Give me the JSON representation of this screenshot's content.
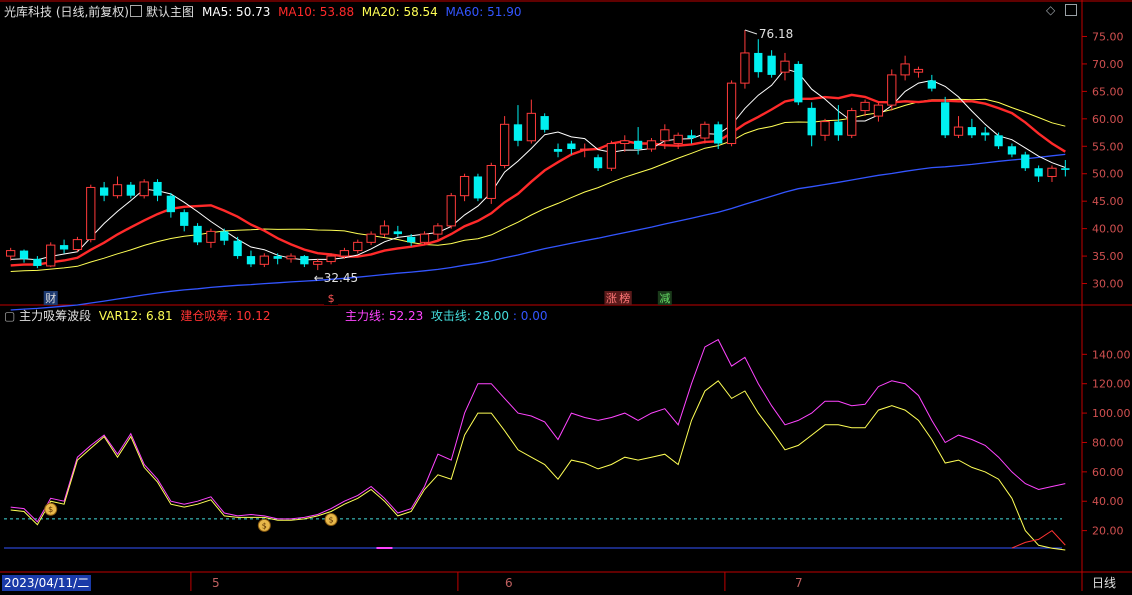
{
  "header": {
    "title": "光库科技 (日线,前复权)",
    "template": "默认主图",
    "ma": [
      {
        "label": "MA5: 50.73",
        "color": "#ffffff"
      },
      {
        "label": "MA10: 53.88",
        "color": "#ff2a2a"
      },
      {
        "label": "MA20: 58.54",
        "color": "#ffff55"
      },
      {
        "label": "MA60: 51.90",
        "color": "#3355ff"
      }
    ]
  },
  "indicator_header": {
    "name": "主力吸筹波段",
    "items": [
      {
        "label": "VAR12: 6.81",
        "color": "#ffff55"
      },
      {
        "label": "建仓吸筹: 10.12",
        "color": "#ff3333"
      },
      {
        "label": "主力线: 52.23",
        "color": "#ff44ff"
      },
      {
        "label": "攻击线: 28.00",
        "color": "#44dddd"
      },
      {
        "label": ": 0.00",
        "color": "#3355ff"
      }
    ]
  },
  "icons": {
    "settings": "diamond-icon",
    "fullscreen": "window-icon"
  },
  "bottom": {
    "date_label": "2023/04/11/二",
    "month_labels": [
      "5",
      "6",
      "7"
    ],
    "period_label": "日线"
  },
  "colors": {
    "up": "#ff3b3b",
    "down": "#00f0f0",
    "grid": "#8b0000",
    "axis": "#c00000"
  },
  "chart_data": [
    {
      "type": "candlestick",
      "ylim": [
        27,
        78
      ],
      "yticks": [
        "30.00",
        "35.00",
        "40.00",
        "45.00",
        "50.00",
        "55.00",
        "60.00",
        "65.00",
        "70.00",
        "75.00"
      ],
      "annotations": {
        "high": "76.18",
        "low": "32.45"
      },
      "markers": [
        "财",
        "$",
        "涨",
        "榜",
        "减"
      ],
      "ohlc": [
        [
          35.0,
          36.5,
          34.2,
          36.0
        ],
        [
          36.0,
          36.2,
          33.8,
          34.5
        ],
        [
          34.5,
          35.0,
          32.8,
          33.2
        ],
        [
          33.2,
          37.5,
          33.0,
          37.0
        ],
        [
          37.0,
          38.0,
          35.5,
          36.2
        ],
        [
          36.2,
          38.5,
          35.8,
          38.0
        ],
        [
          38.0,
          48.0,
          37.5,
          47.5
        ],
        [
          47.5,
          48.5,
          45.0,
          46.0
        ],
        [
          46.0,
          49.5,
          45.5,
          48.0
        ],
        [
          48.0,
          48.5,
          45.5,
          46.0
        ],
        [
          46.0,
          49.0,
          45.5,
          48.5
        ],
        [
          48.5,
          49.0,
          45.0,
          46.0
        ],
        [
          46.0,
          46.5,
          42.0,
          43.0
        ],
        [
          43.0,
          43.5,
          39.5,
          40.5
        ],
        [
          40.5,
          41.0,
          37.0,
          37.5
        ],
        [
          37.5,
          40.0,
          36.5,
          39.5
        ],
        [
          39.5,
          40.0,
          37.0,
          37.8
        ],
        [
          37.8,
          38.5,
          34.5,
          35.0
        ],
        [
          35.0,
          36.0,
          33.0,
          33.5
        ],
        [
          33.5,
          35.5,
          33.0,
          35.0
        ],
        [
          35.0,
          35.5,
          33.5,
          34.5
        ],
        [
          34.5,
          35.5,
          33.8,
          35.0
        ],
        [
          35.0,
          35.2,
          33.0,
          33.5
        ],
        [
          33.5,
          34.5,
          32.45,
          34.0
        ],
        [
          34.0,
          35.5,
          33.5,
          35.0
        ],
        [
          35.0,
          36.5,
          34.5,
          36.0
        ],
        [
          36.0,
          38.0,
          35.5,
          37.5
        ],
        [
          37.5,
          39.5,
          37.0,
          39.0
        ],
        [
          39.0,
          41.5,
          38.5,
          40.5
        ],
        [
          39.5,
          40.5,
          38.5,
          39.0
        ],
        [
          38.5,
          39.0,
          36.8,
          37.5
        ],
        [
          37.5,
          39.5,
          37.0,
          39.0
        ],
        [
          39.0,
          41.0,
          38.0,
          40.5
        ],
        [
          40.5,
          46.5,
          40.0,
          46.0
        ],
        [
          46.0,
          50.0,
          45.0,
          49.5
        ],
        [
          49.5,
          50.0,
          45.0,
          45.5
        ],
        [
          45.5,
          52.0,
          44.5,
          51.5
        ],
        [
          51.5,
          60.5,
          51.0,
          59.0
        ],
        [
          59.0,
          62.5,
          55.0,
          56.0
        ],
        [
          56.0,
          63.5,
          55.5,
          61.0
        ],
        [
          60.5,
          61.0,
          57.5,
          58.0
        ],
        [
          54.5,
          55.5,
          53.0,
          54.0
        ],
        [
          55.5,
          56.0,
          53.5,
          54.5
        ],
        [
          54.5,
          55.5,
          53.0,
          54.5
        ],
        [
          53.0,
          53.5,
          50.5,
          51.0
        ],
        [
          51.0,
          56.0,
          50.5,
          55.5
        ],
        [
          55.5,
          57.0,
          54.0,
          56.0
        ],
        [
          56.0,
          58.5,
          53.5,
          54.5
        ],
        [
          54.5,
          56.5,
          54.0,
          56.0
        ],
        [
          56.0,
          59.0,
          54.5,
          58.0
        ],
        [
          55.5,
          57.5,
          54.5,
          57.0
        ],
        [
          57.0,
          58.0,
          55.5,
          56.5
        ],
        [
          56.5,
          59.5,
          55.5,
          59.0
        ],
        [
          59.0,
          59.5,
          54.5,
          55.5
        ],
        [
          55.5,
          67.0,
          55.0,
          66.5
        ],
        [
          66.5,
          76.18,
          65.5,
          72.0
        ],
        [
          72.0,
          74.5,
          67.5,
          68.5
        ],
        [
          71.5,
          72.5,
          67.5,
          68.0
        ],
        [
          68.5,
          72.0,
          67.0,
          70.5
        ],
        [
          70.0,
          70.5,
          62.5,
          63.0
        ],
        [
          62.0,
          63.0,
          55.0,
          57.0
        ],
        [
          57.0,
          60.0,
          56.0,
          59.5
        ],
        [
          59.5,
          62.5,
          56.0,
          57.0
        ],
        [
          57.0,
          62.0,
          56.5,
          61.5
        ],
        [
          61.5,
          63.5,
          60.5,
          63.0
        ],
        [
          60.5,
          63.0,
          59.5,
          62.5
        ],
        [
          62.5,
          69.0,
          61.5,
          68.0
        ],
        [
          68.0,
          71.5,
          67.0,
          70.0
        ],
        [
          68.5,
          69.5,
          67.5,
          69.0
        ],
        [
          67.0,
          68.0,
          65.0,
          65.5
        ],
        [
          63.0,
          64.0,
          56.5,
          57.0
        ],
        [
          57.0,
          60.5,
          56.5,
          58.5
        ],
        [
          58.5,
          60.0,
          56.5,
          57.0
        ],
        [
          57.5,
          58.5,
          56.0,
          57.0
        ],
        [
          57.0,
          57.5,
          54.5,
          55.0
        ],
        [
          55.0,
          55.5,
          53.0,
          53.5
        ],
        [
          53.5,
          54.0,
          50.5,
          51.0
        ],
        [
          51.0,
          51.5,
          48.5,
          49.5
        ],
        [
          49.5,
          51.5,
          48.5,
          51.0
        ],
        [
          51.0,
          52.5,
          49.5,
          50.7
        ]
      ]
    },
    {
      "type": "line",
      "ylim": [
        0,
        162
      ],
      "yticks": [
        "20.00",
        "40.00",
        "60.00",
        "80.00",
        "100.00",
        "120.00",
        "140.00"
      ],
      "series": [
        {
          "name": "主力线",
          "color": "#ff44ff",
          "values": [
            36,
            35,
            26,
            42,
            40,
            70,
            78,
            85,
            72,
            86,
            65,
            55,
            40,
            38,
            40,
            43,
            32,
            30,
            31,
            30,
            28,
            28,
            29,
            31,
            35,
            40,
            44,
            50,
            42,
            32,
            35,
            50,
            72,
            68,
            100,
            120,
            120,
            110,
            100,
            98,
            94,
            82,
            100,
            97,
            95,
            97,
            100,
            95,
            100,
            103,
            92,
            120,
            145,
            150,
            132,
            138,
            120,
            105,
            92,
            95,
            100,
            108,
            108,
            105,
            106,
            118,
            122,
            120,
            112,
            95,
            80,
            85,
            82,
            78,
            70,
            60,
            52,
            48,
            50,
            52
          ]
        },
        {
          "name": "VAR12",
          "color": "#ffff55",
          "values": [
            34,
            33,
            24,
            40,
            38,
            68,
            76,
            84,
            70,
            84,
            63,
            53,
            38,
            36,
            38,
            41,
            30,
            29,
            29,
            29,
            27,
            27,
            28,
            30,
            33,
            38,
            42,
            48,
            40,
            30,
            33,
            48,
            58,
            55,
            85,
            100,
            100,
            88,
            75,
            70,
            65,
            55,
            68,
            66,
            62,
            65,
            70,
            68,
            70,
            72,
            65,
            95,
            115,
            122,
            110,
            115,
            100,
            88,
            75,
            78,
            85,
            92,
            92,
            90,
            90,
            102,
            105,
            102,
            95,
            82,
            66,
            68,
            63,
            60,
            55,
            42,
            20,
            10,
            8,
            6.81
          ]
        },
        {
          "name": "攻击线",
          "color": "#44dddd",
          "dashed": true,
          "constant": 28
        },
        {
          "name": "建仓吸筹",
          "color": "#ff3333",
          "values": [
            0,
            0,
            0,
            0,
            0,
            0,
            0,
            0,
            0,
            0,
            0,
            0,
            0,
            0,
            0,
            0,
            0,
            0,
            0,
            0,
            0,
            0,
            0,
            0,
            0,
            0,
            0,
            0,
            0,
            0,
            0,
            0,
            0,
            0,
            0,
            0,
            0,
            0,
            0,
            0,
            0,
            0,
            0,
            0,
            0,
            0,
            0,
            0,
            0,
            0,
            0,
            0,
            0,
            0,
            0,
            0,
            0,
            0,
            0,
            0,
            0,
            0,
            0,
            0,
            0,
            0,
            0,
            0,
            0,
            0,
            0,
            0,
            0,
            0,
            0,
            0,
            12,
            14,
            20,
            10.12
          ]
        }
      ],
      "money_bag_markers": [
        3,
        19,
        24
      ]
    }
  ]
}
